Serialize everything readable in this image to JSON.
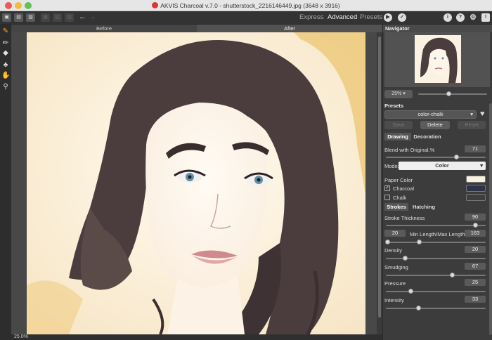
{
  "window": {
    "title": "AKVIS Charcoal v.7.0 - shutterstock_2216146449.jpg (3648 x 3916)"
  },
  "toolbar": {
    "modes": [
      "Express",
      "Advanced",
      "Presets"
    ],
    "active_mode": "Advanced",
    "icons": [
      "open-icon",
      "save-icon",
      "save-as-icon",
      "print-icon",
      "share-icon",
      "batch-icon",
      "undo-icon",
      "redo-icon",
      "run-icon",
      "apply-icon",
      "info-icon",
      "help-icon",
      "settings-icon",
      "tips-icon"
    ]
  },
  "tools": [
    "brush-icon",
    "pencil-icon",
    "eraser-icon",
    "stamp-icon",
    "hand-icon",
    "zoom-icon"
  ],
  "image_tabs": {
    "before": "Before",
    "after": "After"
  },
  "status": {
    "zoom": "25.0%"
  },
  "navigator": {
    "title": "Navigator",
    "zoom": "25%",
    "zoom_fraction": 0.45
  },
  "presets": {
    "label": "Presets",
    "selected": "color-chalk",
    "buttons": {
      "save": "Save",
      "delete": "Delete",
      "reset": "Reset"
    }
  },
  "drawing_tabs": {
    "drawing": "Drawing",
    "decoration": "Decoration"
  },
  "blend": {
    "label": "Blend with Original,%",
    "value": "71",
    "fraction": 0.71
  },
  "mode": {
    "label": "Mode:",
    "value": "Color"
  },
  "paper_color": {
    "label": "Paper Color",
    "color": "#f8f1de"
  },
  "charcoal": {
    "label": "Charcoal",
    "checked": "✓",
    "color": "#2d3348"
  },
  "chalk": {
    "label": "Chalk",
    "color": "#3e3e3e"
  },
  "stroke_tabs": {
    "strokes": "Strokes",
    "hatching": "Hatching"
  },
  "params": {
    "stroke_thickness": {
      "label": "Stroke Thickness",
      "value": "90",
      "fraction": 0.9
    },
    "min_max_length": {
      "label": "Min Length/Max Length",
      "min": "20",
      "max": "163",
      "min_fraction": 0.02,
      "max_fraction": 0.34
    },
    "density": {
      "label": "Density",
      "value": "20",
      "fraction": 0.2
    },
    "smudging": {
      "label": "Smudging",
      "value": "67",
      "fraction": 0.67
    },
    "pressure": {
      "label": "Pressure",
      "value": "25",
      "fraction": 0.25
    },
    "intensity": {
      "label": "Intensity",
      "value": "33",
      "fraction": 0.33
    }
  }
}
